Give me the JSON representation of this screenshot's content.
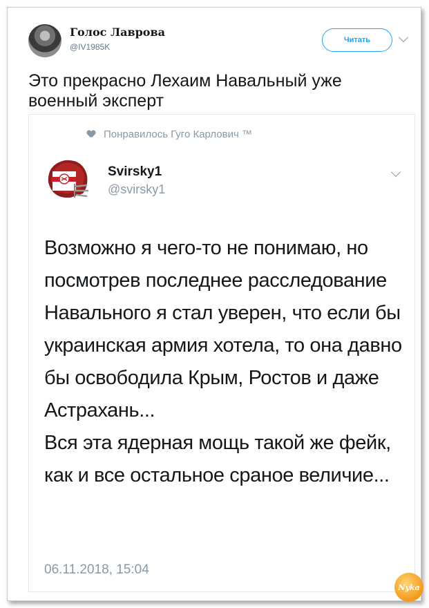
{
  "tweet": {
    "author_name": "Голос Лаврова",
    "author_handle": "@IV1985K",
    "follow_button_label": "Читать",
    "text": "Это прекрасно Лехаим Навальный уже военный эксперт"
  },
  "quoted": {
    "liked_by_text": "Понравилось Гуго Карлович ™",
    "author_name": "Svirsky1",
    "author_handle": "@svirsky1",
    "paragraphs": [
      "Возможно я чего-то не понимаю, но посмотрев последнее расследование Навального я стал уверен, что если бы украинская армия хотела, то она давно бы освободила Крым, Ростов и даже Астрахань...",
      "Вся эта ядерная мощь такой же фейк, как и все остальное сраное величие..."
    ],
    "date": "06.11.2018, 15:04"
  },
  "watermark_text": "Nyka",
  "colors": {
    "accent": "#1da1f2",
    "secondary_text": "#8899a6",
    "primary_text": "#14171a"
  },
  "icons": {
    "liked": "heart-icon",
    "menu": "chevron-down-icon"
  }
}
